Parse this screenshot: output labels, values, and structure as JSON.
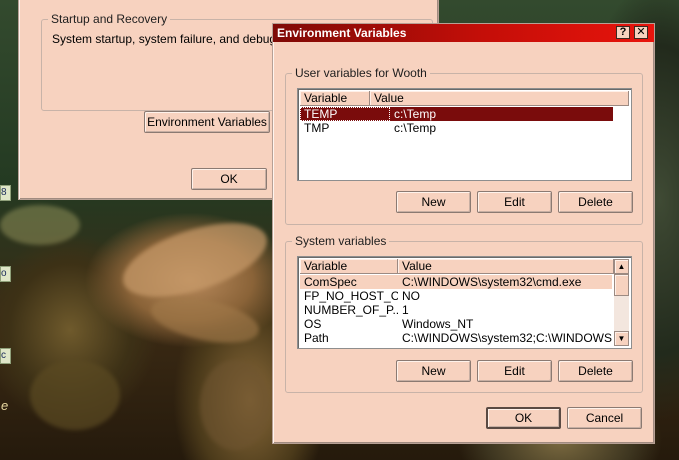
{
  "background_window": {
    "group_title": "Startup and Recovery",
    "group_text": "System startup, system failure, and debugging i",
    "env_button": "Environment Variables",
    "ok_button": "OK"
  },
  "dialog": {
    "title": "Environment Variables",
    "help_button": "?",
    "close_button": "✕",
    "user_group_title": "User variables for Wooth",
    "system_group_title": "System variables",
    "columns": {
      "variable": "Variable",
      "value": "Value"
    },
    "user_vars": [
      {
        "variable": "TEMP",
        "value": "c:\\Temp"
      },
      {
        "variable": "TMP",
        "value": "c:\\Temp"
      }
    ],
    "system_vars": [
      {
        "variable": "ComSpec",
        "value": "C:\\WINDOWS\\system32\\cmd.exe"
      },
      {
        "variable": "FP_NO_HOST_C...",
        "value": "NO"
      },
      {
        "variable": "NUMBER_OF_P...",
        "value": "1"
      },
      {
        "variable": "OS",
        "value": "Windows_NT"
      },
      {
        "variable": "Path",
        "value": "C:\\WINDOWS\\system32;C:\\WINDOWS;..."
      }
    ],
    "user_buttons": {
      "new": "New",
      "edit": "Edit",
      "delete": "Delete"
    },
    "system_buttons": {
      "new": "New",
      "edit": "Edit",
      "delete": "Delete"
    },
    "ok_button": "OK",
    "cancel_button": "Cancel"
  },
  "desktop": {
    "edge_labels": [
      "8",
      "o",
      "c",
      "e"
    ]
  },
  "colors": {
    "window_face": "#f7d2bf",
    "titlebar_dark": "#7e0a06",
    "titlebar_light": "#e8140c",
    "selection": "#7a0c0c"
  }
}
